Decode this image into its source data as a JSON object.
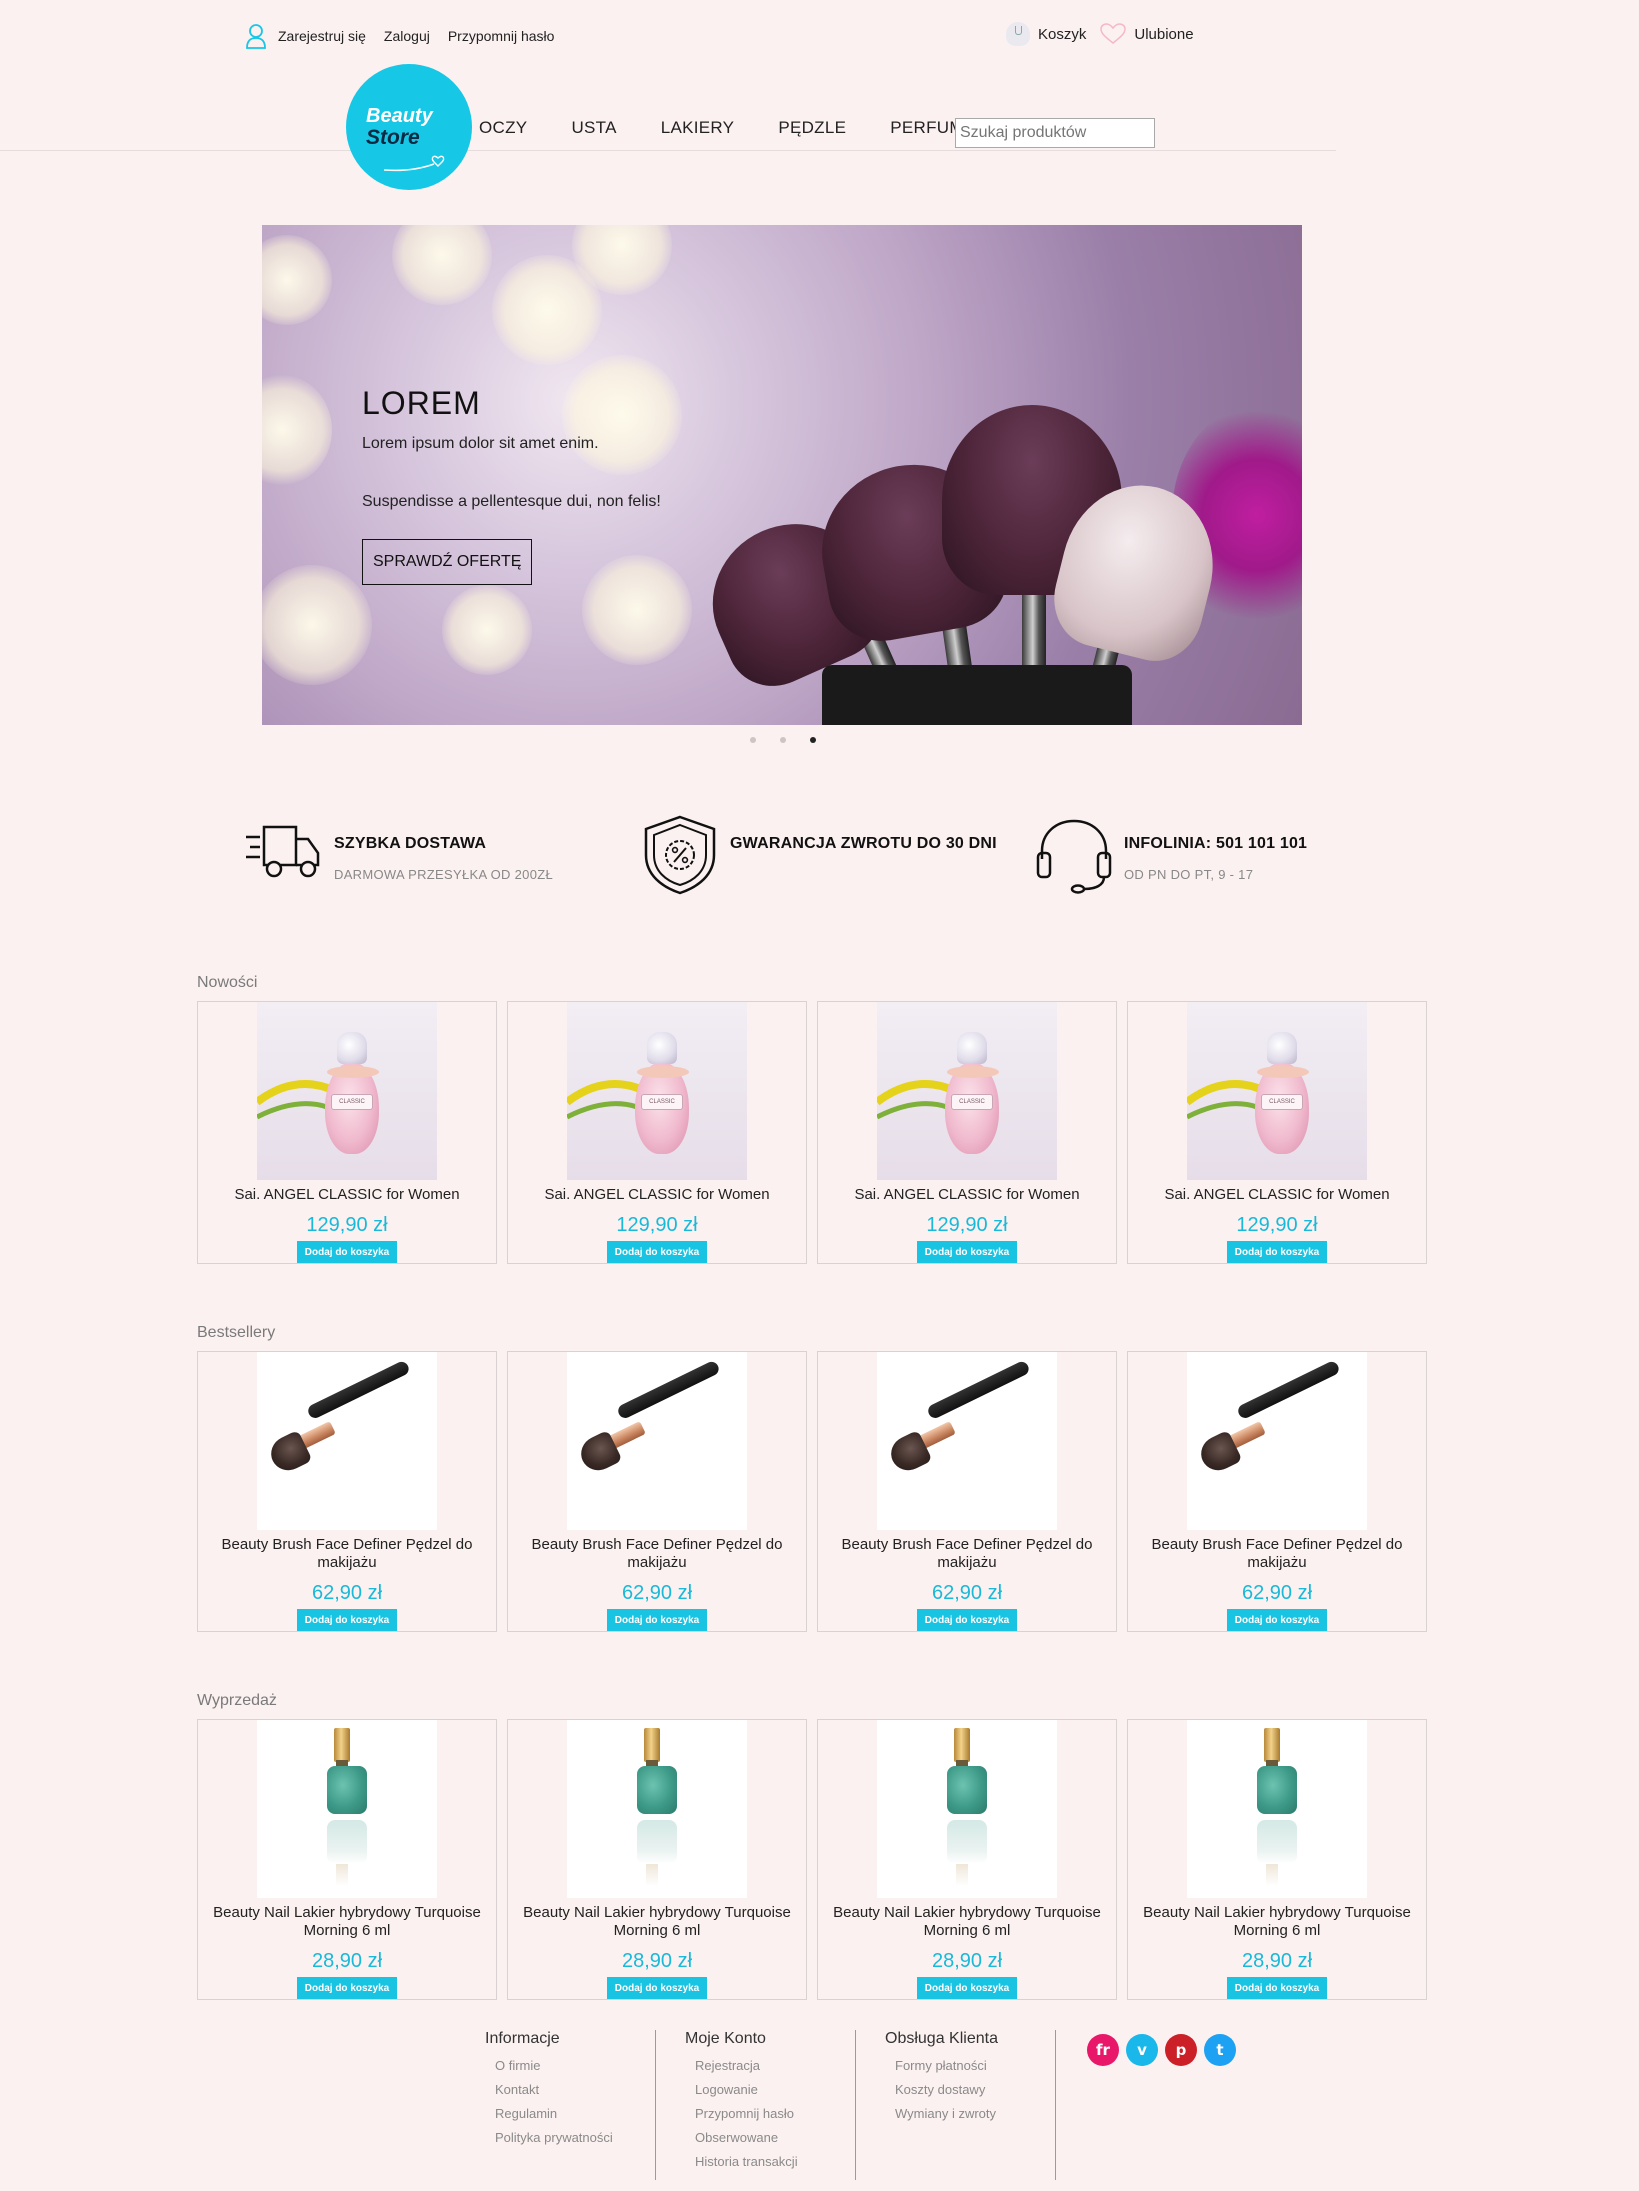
{
  "header": {
    "top_links": [
      "Zarejestruj się",
      "Zaloguj",
      "Przypomnij hasło"
    ],
    "cart_label": "Koszyk",
    "favorites_label": "Ulubione",
    "logo_line1": "Beauty",
    "logo_line2": "Store",
    "nav": [
      "OCZY",
      "USTA",
      "LAKIERY",
      "PĘDZLE",
      "PERFUMY"
    ],
    "search_placeholder": "Szukaj produktów",
    "brand_color": "#16c7e6"
  },
  "hero": {
    "title": "LOREM",
    "line1": "Lorem ipsum dolor sit amet enim.",
    "line2": "Suspendisse a pellentesque dui, non felis!",
    "button": "SPRAWDŹ OFERTĘ",
    "slides": 3,
    "active_slide": 3
  },
  "features": [
    {
      "icon": "delivery-truck-icon",
      "title": "SZYBKA DOSTAWA",
      "subtitle": "DARMOWA PRZESYŁKA OD 200ZŁ"
    },
    {
      "icon": "shield-percent-icon",
      "title": "GWARANCJA ZWROTU DO 30 DNI",
      "subtitle": ""
    },
    {
      "icon": "headset-icon",
      "title": "INFOLINIA: 501 101 101",
      "subtitle": "OD PN DO PT, 9 - 17"
    }
  ],
  "sections": [
    {
      "title": "Nowości",
      "products": [
        {
          "name": "Sai. ANGEL CLASSIC for Women",
          "price": "129,90 zł",
          "button": "Dodaj do koszyka"
        },
        {
          "name": "Sai. ANGEL CLASSIC for Women",
          "price": "129,90 zł",
          "button": "Dodaj do koszyka"
        },
        {
          "name": "Sai. ANGEL CLASSIC for Women",
          "price": "129,90 zł",
          "button": "Dodaj do koszyka"
        },
        {
          "name": "Sai. ANGEL CLASSIC for Women",
          "price": "129,90 zł",
          "button": "Dodaj do koszyka"
        }
      ]
    },
    {
      "title": "Bestsellery",
      "products": [
        {
          "name": "Beauty Brush Face Definer Pędzel do makijażu",
          "price": "62,90 zł",
          "button": "Dodaj do koszyka"
        },
        {
          "name": "Beauty Brush Face Definer Pędzel do makijażu",
          "price": "62,90 zł",
          "button": "Dodaj do koszyka"
        },
        {
          "name": "Beauty Brush Face Definer Pędzel do makijażu",
          "price": "62,90 zł",
          "button": "Dodaj do koszyka"
        },
        {
          "name": "Beauty Brush Face Definer Pędzel do makijażu",
          "price": "62,90 zł",
          "button": "Dodaj do koszyka"
        }
      ]
    },
    {
      "title": "Wyprzedaż",
      "products": [
        {
          "name": "Beauty Nail Lakier hybrydowy Turquoise Morning 6 ml",
          "price": "28,90 zł",
          "button": "Dodaj do koszyka"
        },
        {
          "name": "Beauty Nail Lakier hybrydowy Turquoise Morning 6 ml",
          "price": "28,90 zł",
          "button": "Dodaj do koszyka"
        },
        {
          "name": "Beauty Nail Lakier hybrydowy Turquoise Morning 6 ml",
          "price": "28,90 zł",
          "button": "Dodaj do koszyka"
        },
        {
          "name": "Beauty Nail Lakier hybrydowy Turquoise Morning 6 ml",
          "price": "28,90 zł",
          "button": "Dodaj do koszyka"
        }
      ]
    }
  ],
  "footer": {
    "columns": [
      {
        "title": "Informacje",
        "links": [
          "O firmie",
          "Kontakt",
          "Regulamin",
          "Polityka prywatności"
        ]
      },
      {
        "title": "Moje Konto",
        "links": [
          "Rejestracja",
          "Logowanie",
          "Przypomnij hasło",
          "Obserwowane",
          "Historia transakcji"
        ]
      },
      {
        "title": "Obsługa Klienta",
        "links": [
          "Formy płatności",
          "Koszty dostawy",
          "Wymiany i zwroty"
        ]
      }
    ],
    "social": [
      {
        "label": "fr",
        "icon": "foursquare-icon",
        "color": "#e8176a"
      },
      {
        "label": "v",
        "icon": "vimeo-icon",
        "color": "#1ab7ea"
      },
      {
        "label": "p",
        "icon": "pinterest-icon",
        "color": "#cb2027"
      },
      {
        "label": "t",
        "icon": "twitter-icon",
        "color": "#1da1f2"
      }
    ]
  }
}
